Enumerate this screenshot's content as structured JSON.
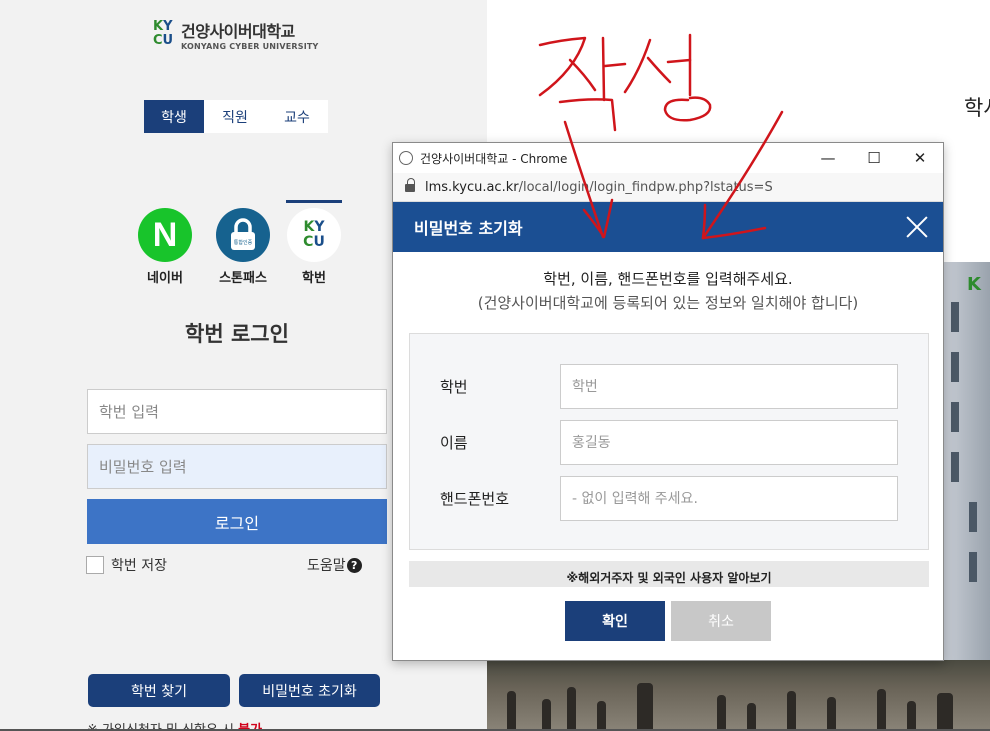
{
  "left": {
    "logo_korean": "건양사이버대학교",
    "logo_english": "KONYANG CYBER UNIVERSITY",
    "role_tabs": [
      {
        "label": "학생",
        "active": true
      },
      {
        "label": "직원",
        "active": false
      },
      {
        "label": "교수",
        "active": false
      }
    ],
    "login_methods": [
      {
        "label": "네이버",
        "icon": "naver-icon",
        "glyph": "N"
      },
      {
        "label": "스톤패스",
        "icon": "stonepass-lock-icon",
        "glyph": "통합인증"
      },
      {
        "label": "학번",
        "icon": "kycu-icon",
        "glyph": "KYCU"
      }
    ],
    "login_title": "학번 로그인",
    "id_placeholder": "학번 입력",
    "pw_placeholder": "비밀번호 입력",
    "login_button": "로그인",
    "save_id_label": "학번 저장",
    "help_label": "도움말",
    "find_id_button": "학번 찾기",
    "reset_pw_button": "비밀번호 초기화",
    "notice_prefix": "※ 가입신청자 및 신학우 시 ",
    "notice_red": "불가"
  },
  "right": {
    "heading_partial": "학사",
    "building_logo": "K"
  },
  "annotation": {
    "handwritten_text": "작성",
    "color": "#d0151b"
  },
  "popup": {
    "window_title": "건양사이버대학교 - Chrome",
    "url_domain": "lms.kycu.ac.kr",
    "url_path": "/local/login/login_findpw.php?lstatus=S",
    "modal_title": "비밀번호 초기화",
    "instruction_main": "학번, 이름, 핸드폰번호를 입력해주세요.",
    "instruction_sub": "(건양사이버대학교에 등록되어 있는 정보와 일치해야 합니다)",
    "fields": [
      {
        "label": "학번",
        "placeholder": "학번"
      },
      {
        "label": "이름",
        "placeholder": "홍길동"
      },
      {
        "label": "핸드폰번호",
        "placeholder": "- 없이 입력해 주세요."
      }
    ],
    "foreign_notice": "※해외거주자 및 외국인 사용자 알아보기",
    "confirm_button": "확인",
    "cancel_button": "취소",
    "accent_color": "#1b4f93"
  }
}
